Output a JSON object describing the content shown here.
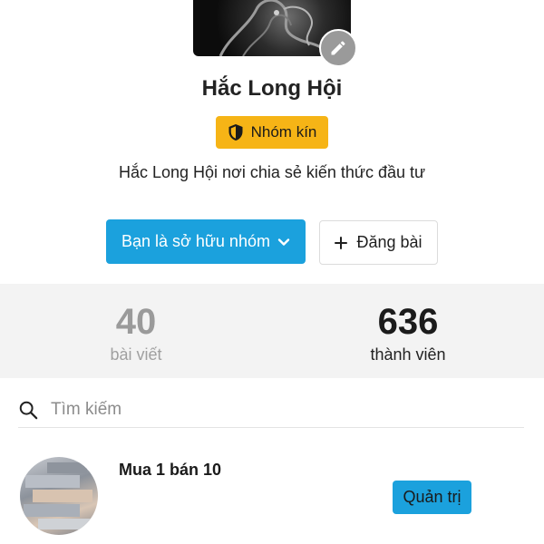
{
  "group": {
    "name": "Hắc Long Hội",
    "privacy_badge": "Nhóm kín",
    "description": "Hắc Long Hội nơi chia sẻ kiến thức đầu tư"
  },
  "actions": {
    "owner_label": "Bạn là sở hữu nhóm",
    "post_label": "Đăng bài"
  },
  "stats": {
    "posts_count": "40",
    "posts_label": "bài viết",
    "members_count": "636",
    "members_label": "thành viên"
  },
  "search": {
    "placeholder": "Tìm kiếm"
  },
  "list": {
    "items": [
      {
        "title": "Mua 1 bán 10",
        "action_label": "Quản trị"
      }
    ]
  },
  "icons": {
    "edit": "pencil-icon",
    "badge": "shield-icon",
    "dropdown": "chevron-down-icon",
    "add": "plus-icon",
    "search": "search-icon"
  },
  "colors": {
    "accent_blue": "#1ba1dd",
    "badge_yellow": "#f6b416",
    "stats_bg": "#f3f3f3"
  }
}
